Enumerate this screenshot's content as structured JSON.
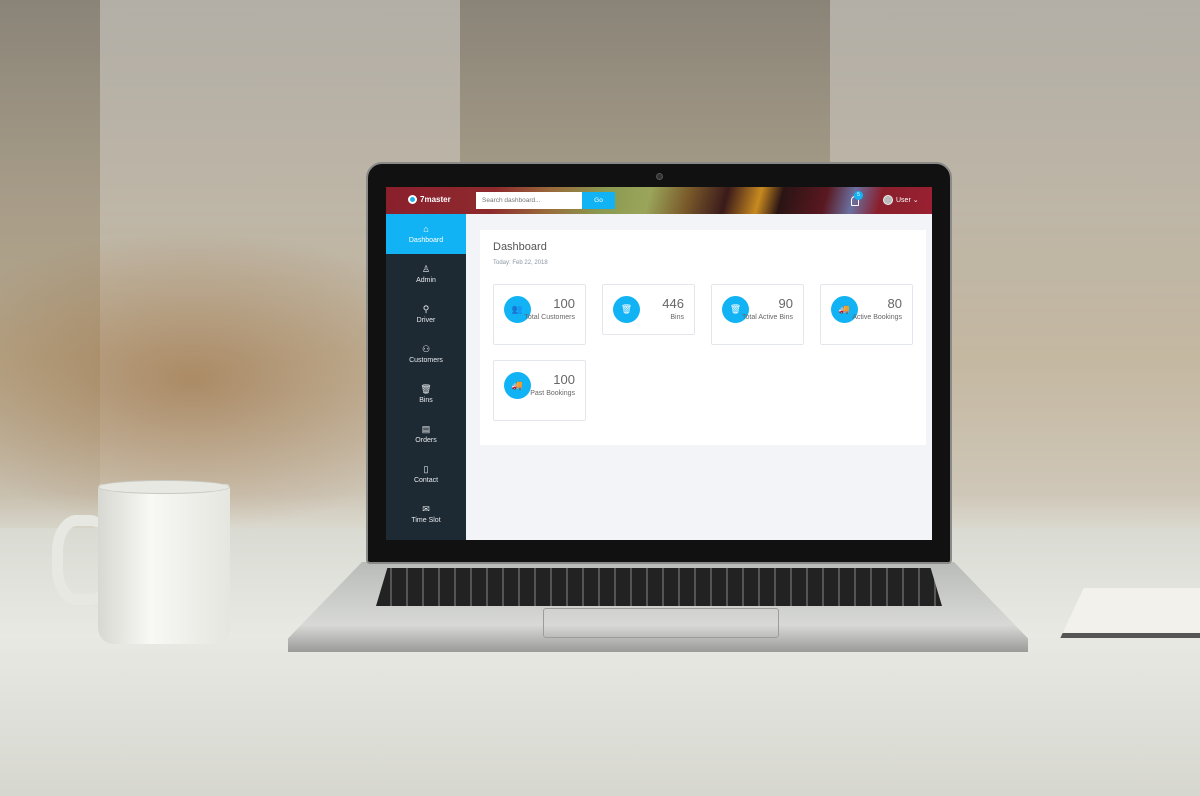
{
  "header": {
    "brand": "7master",
    "search_placeholder": "Search dashboard...",
    "go_label": "Go",
    "notification_count": "5",
    "user_label": "User ⌄"
  },
  "sidebar": {
    "items": [
      {
        "label": "Dashboard",
        "icon": "⌂",
        "active": true
      },
      {
        "label": "Admin",
        "icon": "♙"
      },
      {
        "label": "Driver",
        "icon": "⚲"
      },
      {
        "label": "Customers",
        "icon": "⚇"
      },
      {
        "label": "Bins",
        "icon": "🗑"
      },
      {
        "label": "Orders",
        "icon": "▤"
      },
      {
        "label": "Contact",
        "icon": "▯"
      },
      {
        "label": "Time Slot",
        "icon": "✉"
      }
    ]
  },
  "main": {
    "title": "Dashboard",
    "date": "Today: Feb 22, 2018",
    "stats": [
      {
        "value": "100",
        "label": "Total Customers",
        "icon": "users-icon"
      },
      {
        "value": "446",
        "label": "Bins",
        "icon": "trash-icon"
      },
      {
        "value": "90",
        "label": "Total Active Bins",
        "icon": "trash-icon"
      },
      {
        "value": "80",
        "label": "Active Bookings",
        "icon": "truck-icon"
      },
      {
        "value": "100",
        "label": "Past Bookings",
        "icon": "truck-icon"
      }
    ]
  },
  "colors": {
    "accent": "#12b3f4",
    "sidebar": "#1e2a33"
  }
}
